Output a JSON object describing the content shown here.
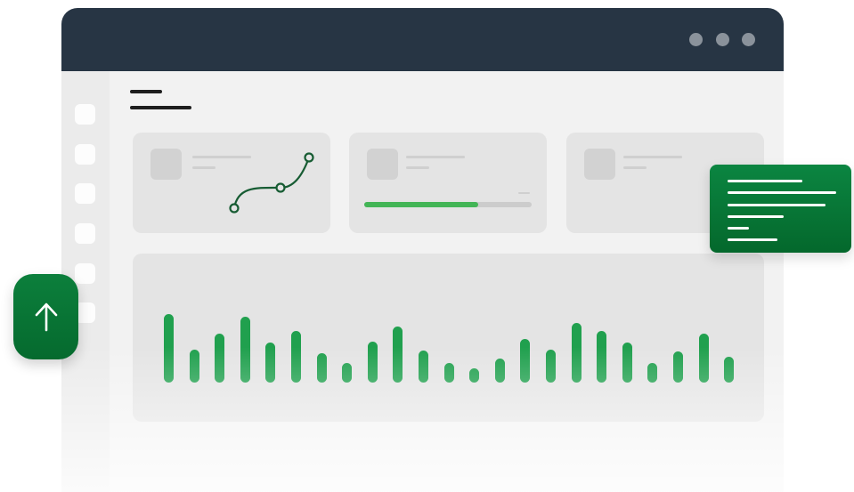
{
  "colors": {
    "titlebar": "#273544",
    "accent_green": "#20a04e",
    "progress_green": "#43b556",
    "dark_green": "#056a2e",
    "surface": "#f2f2f2",
    "card": "#e4e4e4"
  },
  "window": {
    "title_dots": [
      "dot",
      "dot",
      "dot"
    ]
  },
  "sidebar": {
    "items": [
      {
        "icon": "placeholder"
      },
      {
        "icon": "placeholder"
      },
      {
        "icon": "placeholder"
      },
      {
        "icon": "placeholder"
      },
      {
        "icon": "placeholder"
      },
      {
        "icon": "placeholder"
      }
    ]
  },
  "cards": [
    {
      "kind": "trend",
      "icon": "placeholder-icon"
    },
    {
      "kind": "progress",
      "icon": "placeholder-icon",
      "progress": 0.68
    },
    {
      "kind": "stat",
      "icon": "placeholder-icon"
    }
  ],
  "chart_data": {
    "type": "bar",
    "values": [
      86,
      41,
      61,
      82,
      50,
      64,
      37,
      25,
      51,
      70,
      40,
      25,
      18,
      30,
      55,
      41,
      75,
      64,
      50,
      25,
      39,
      61,
      32
    ]
  },
  "upload_button": {
    "icon": "arrow-up-icon"
  },
  "floating_card": {
    "icon": "text-lines"
  }
}
